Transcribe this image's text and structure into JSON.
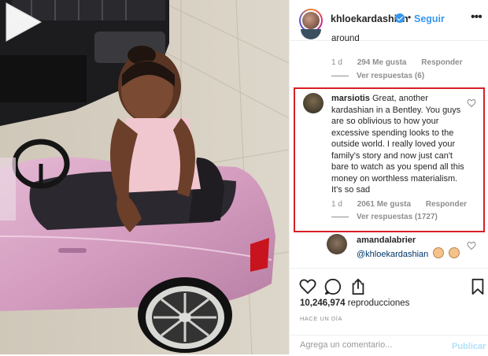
{
  "header": {
    "username": "khloekardashian",
    "separator": "•",
    "follow_label": "Seguir",
    "more_glyph": "•••"
  },
  "previous_comment": {
    "text_tail": "around",
    "age": "1 d",
    "likes": "294 Me gusta",
    "reply_label": "Responder",
    "view_replies": "Ver respuestas (6)"
  },
  "highlighted_comment": {
    "username": "marsiotis",
    "text": "Great, another kardashian in a Bentley. You guys are so oblivious to how your excessive spending looks to the outside world. I really loved your family's story and now just can't bare to watch as you spend all this money on worthless materialism. It's so sad",
    "age": "1 d",
    "likes": "2061 Me gusta",
    "reply_label": "Responder",
    "view_replies": "Ver respuestas (1727)",
    "highlight_color": "#d81e27"
  },
  "reply_comment": {
    "username": "amandalabrier",
    "mention": "@khloekardashian"
  },
  "actions": {
    "views_count": "10,246,974",
    "views_label": "reproducciones",
    "timestamp": "HACE UN DÍA",
    "comment_placeholder": "Agrega un comentario...",
    "publish_label": "Publicar"
  },
  "icons": [
    "play-icon",
    "verified-icon",
    "heart-icon",
    "comment-icon",
    "share-icon",
    "bookmark-icon",
    "more-icon"
  ],
  "colors": {
    "link_blue": "#3897f0",
    "mention_blue": "#003569",
    "publish_disabled": "#b2dffc",
    "meta_gray": "#8e8e8e",
    "car_pink": "#d9a6c8"
  }
}
